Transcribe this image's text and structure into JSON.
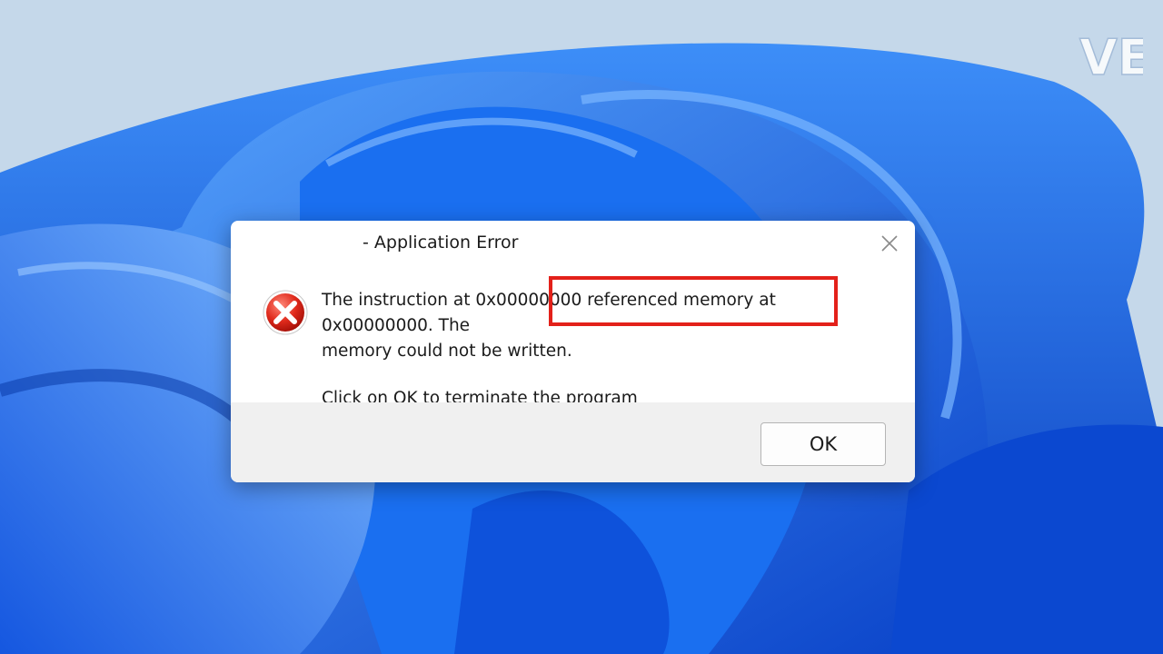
{
  "dialog": {
    "title": "- Application Error",
    "message_line1": "The instruction at 0x00000000 referenced memory at 0x00000000. The",
    "message_line2": "memory could not be written.",
    "message_line3": "Click on OK to terminate the program",
    "ok_label": "OK",
    "close_icon": "close-icon",
    "status_icon": "error-icon"
  },
  "annotation": {
    "highlight_color": "#e3211a"
  },
  "watermark": {
    "text": "VE"
  },
  "colors": {
    "wallpaper_bg": "#c5d8ea",
    "wallpaper_blue": "#1a6ff0",
    "dialog_footer": "#f0f0f0"
  }
}
